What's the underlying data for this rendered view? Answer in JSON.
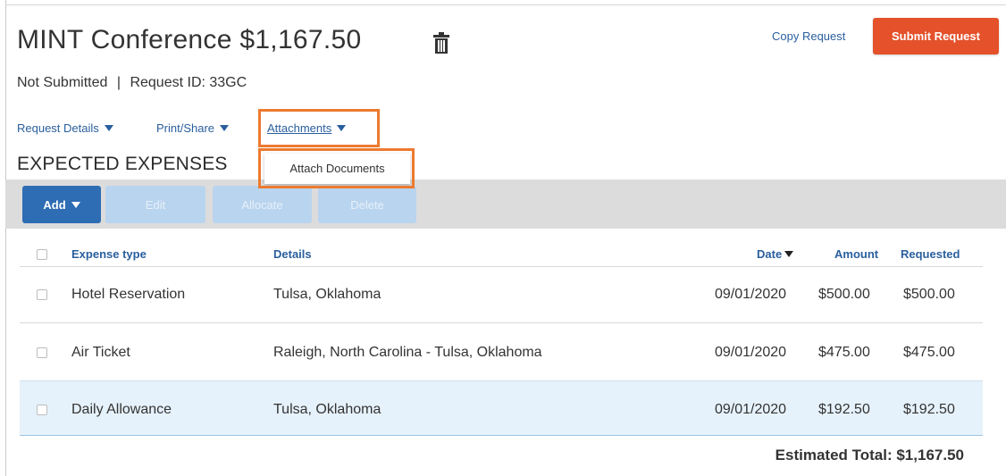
{
  "header": {
    "title": "MINT Conference $1,167.50",
    "status": "Not Submitted",
    "separator": "|",
    "request_id": "Request ID: 33GC",
    "copy_label": "Copy Request",
    "submit_label": "Submit Request"
  },
  "menus": {
    "request_details": "Request Details",
    "print_share": "Print/Share",
    "attachments": "Attachments",
    "attach_documents": "Attach Documents"
  },
  "section_title": "EXPECTED EXPENSES",
  "toolbar": {
    "add": "Add",
    "edit": "Edit",
    "allocate": "Allocate",
    "delete": "Delete"
  },
  "table": {
    "columns": [
      "Expense type",
      "Details",
      "Date",
      "Amount",
      "Requested"
    ],
    "rows": [
      {
        "type": "Hotel Reservation",
        "details": "Tulsa, Oklahoma",
        "date": "09/01/2020",
        "amount": "$500.00",
        "requested": "$500.00"
      },
      {
        "type": "Air Ticket",
        "details": "Raleigh, North Carolina - Tulsa, Oklahoma",
        "date": "09/01/2020",
        "amount": "$475.00",
        "requested": "$475.00"
      },
      {
        "type": "Daily Allowance",
        "details": "Tulsa, Oklahoma",
        "date": "09/01/2020",
        "amount": "$192.50",
        "requested": "$192.50"
      }
    ]
  },
  "estimated_total": "Estimated Total: $1,167.50",
  "colors": {
    "accent": "#2e6db4",
    "link": "#2a5f9e",
    "submit": "#e4512b",
    "highlight": "#ec7a30",
    "selected_row": "#e6f2fb"
  },
  "icons": {
    "delete": "trash-icon",
    "dropdown": "caret-down-icon"
  }
}
